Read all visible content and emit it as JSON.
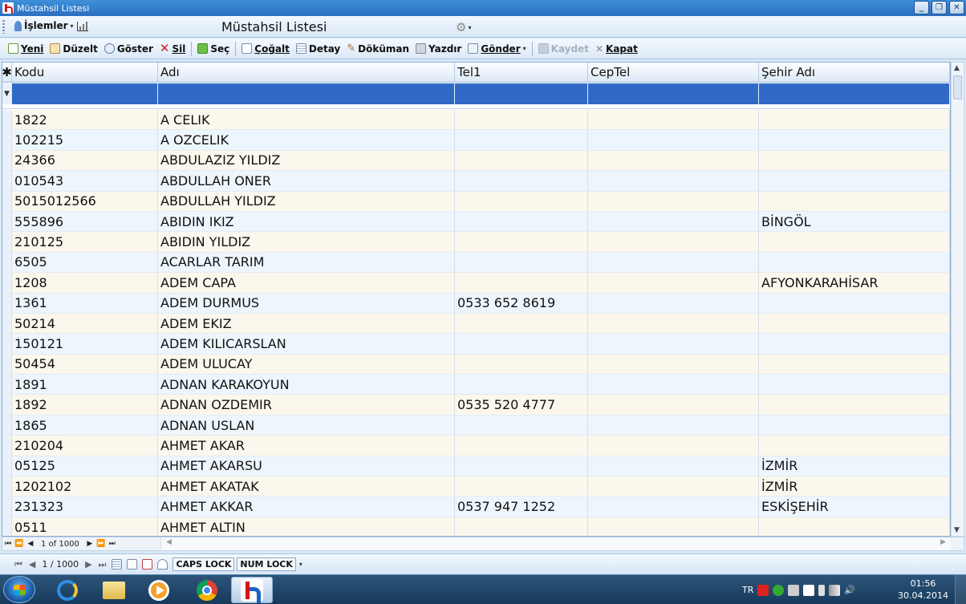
{
  "window": {
    "title": "Müstahsil Listesi",
    "btn_minimize": "_",
    "btn_restore": "❐",
    "btn_close": "✕"
  },
  "menubar": {
    "menu_label": "İşlemler",
    "form_title": "Müstahsil Listesi"
  },
  "toolbar": {
    "yeni": "Yeni",
    "duzelt": "Düzelt",
    "goster": "Göster",
    "sil": "Sil",
    "sec": "Seç",
    "cogalt": "Çoğalt",
    "detay": "Detay",
    "dokuman": "Döküman",
    "yazdir": "Yazdır",
    "gonder": "Gönder",
    "kaydet": "Kaydet",
    "kapat": "Kapat"
  },
  "grid": {
    "columns": [
      "Kodu",
      "Adı",
      "Tel1",
      "CepTel",
      "Şehir Adı"
    ],
    "rows": [
      [
        "1822",
        "A CELIK",
        "",
        "",
        ""
      ],
      [
        "102215",
        "A OZCELIK",
        "",
        "",
        ""
      ],
      [
        "24366",
        "ABDULAZIZ YILDIZ",
        "",
        "",
        ""
      ],
      [
        "010543",
        "ABDULLAH ONER",
        "",
        "",
        ""
      ],
      [
        "5015012566",
        "ABDULLAH YILDIZ",
        "",
        "",
        ""
      ],
      [
        "555896",
        "ABIDIN IKIZ",
        "",
        "",
        "BİNGÖL"
      ],
      [
        "210125",
        "ABIDIN YILDIZ",
        "",
        "",
        ""
      ],
      [
        "6505",
        "ACARLAR TARIM",
        "",
        "",
        ""
      ],
      [
        "1208",
        "ADEM CAPA",
        "",
        "",
        "AFYONKARAHİSAR"
      ],
      [
        "1361",
        "ADEM DURMUS",
        "0533 652 8619",
        "",
        ""
      ],
      [
        "50214",
        "ADEM EKIZ",
        "",
        "",
        ""
      ],
      [
        "150121",
        "ADEM KILICARSLAN",
        "",
        "",
        ""
      ],
      [
        "50454",
        "ADEM ULUCAY",
        "",
        "",
        ""
      ],
      [
        "1891",
        "ADNAN KARAKOYUN",
        "",
        "",
        ""
      ],
      [
        "1892",
        "ADNAN OZDEMIR",
        "0535 520 4777",
        "",
        ""
      ],
      [
        "1865",
        "ADNAN USLAN",
        "",
        "",
        ""
      ],
      [
        "210204",
        "AHMET AKAR",
        "",
        "",
        ""
      ],
      [
        "05125",
        "AHMET AKARSU",
        "",
        "",
        "İZMİR"
      ],
      [
        "1202102",
        "AHMET AKATAK",
        "",
        "",
        "İZMİR"
      ],
      [
        "231323",
        "AHMET AKKAR",
        "0537 947 1252",
        "",
        "ESKİŞEHİR"
      ],
      [
        "0511",
        "AHMET ALTIN",
        "",
        "",
        ""
      ]
    ]
  },
  "gridnav": {
    "record": "1 of 1000"
  },
  "statusbar": {
    "record": "1 / 1000",
    "caps_lock": "CAPS LOCK",
    "num_lock": "NUM LOCK"
  },
  "taskbar": {
    "lang": "TR",
    "time": "01:56",
    "date": "30.04.2014"
  }
}
